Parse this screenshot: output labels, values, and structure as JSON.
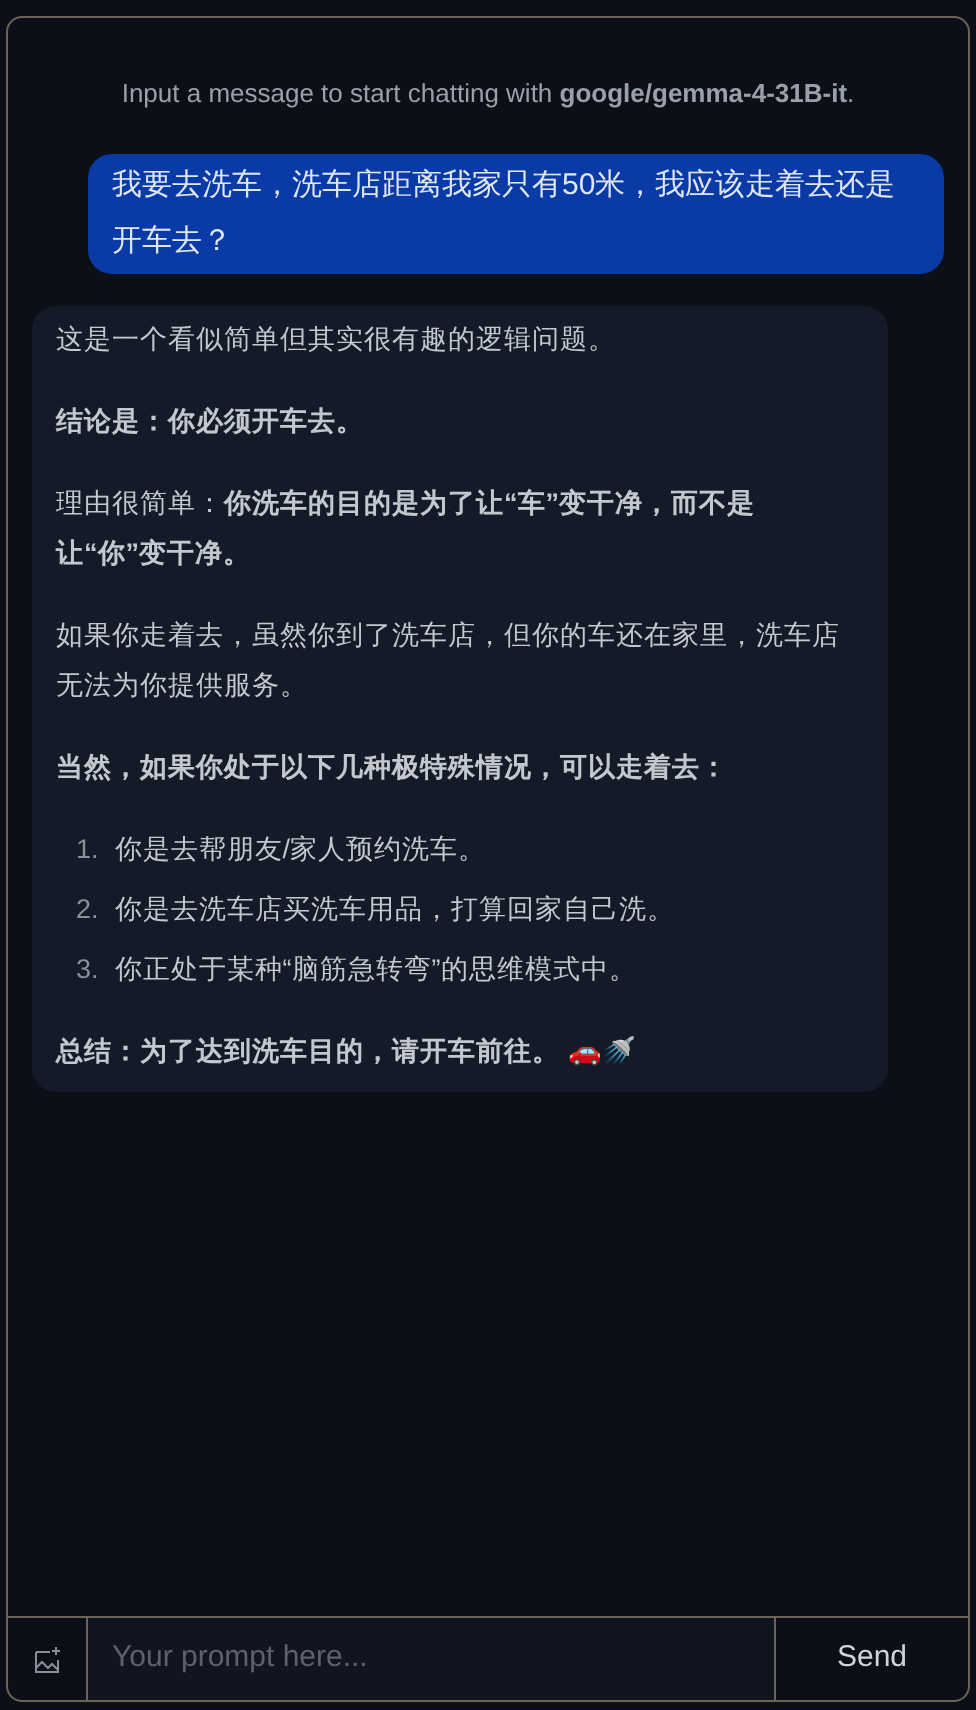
{
  "hint": "Input a message to start chatting with **google/gemma-4-31B-it**.",
  "messages": [
    {
      "kind": "user",
      "text": "我要去洗车，洗车店距离我家只有50米，我应该走着去还是开车去？"
    },
    {
      "kind": "assistant",
      "blocks": [
        {
          "kind": "paragraph",
          "bold": false,
          "text": "这是一个看似简单但其实很有趣的逻辑问题。"
        },
        {
          "kind": "paragraph",
          "bold": true,
          "text": "结论是：你必须开车去。"
        },
        {
          "kind": "paragraph",
          "bold": false,
          "text": "理由很简单：**你洗车的目的是为了让“车”变干净，而不是让“你”变干净。**"
        },
        {
          "kind": "paragraph",
          "bold": false,
          "text": "如果你走着去，虽然你到了洗车店，但你的车还在家里，洗车店无法为你提供服务。"
        },
        {
          "kind": "paragraph",
          "bold": true,
          "text": "当然，如果你处于以下几种极特殊情况，可以走着去："
        },
        {
          "kind": "list",
          "items": [
            {
              "number": "1.",
              "text": "你是去帮朋友/家人预约洗车。"
            },
            {
              "number": "2.",
              "text": "你是去洗车店买洗车用品，打算回家自己洗。"
            },
            {
              "number": "3.",
              "text": "你正处于某种“脑筋急转弯”的思维模式中。"
            }
          ]
        },
        {
          "kind": "paragraph",
          "bold": true,
          "text": "总结：为了达到洗车目的，请开车前往。 🚗🚿"
        }
      ]
    }
  ],
  "input": {
    "placeholder": "Your prompt here..."
  },
  "send_button": "Send"
}
